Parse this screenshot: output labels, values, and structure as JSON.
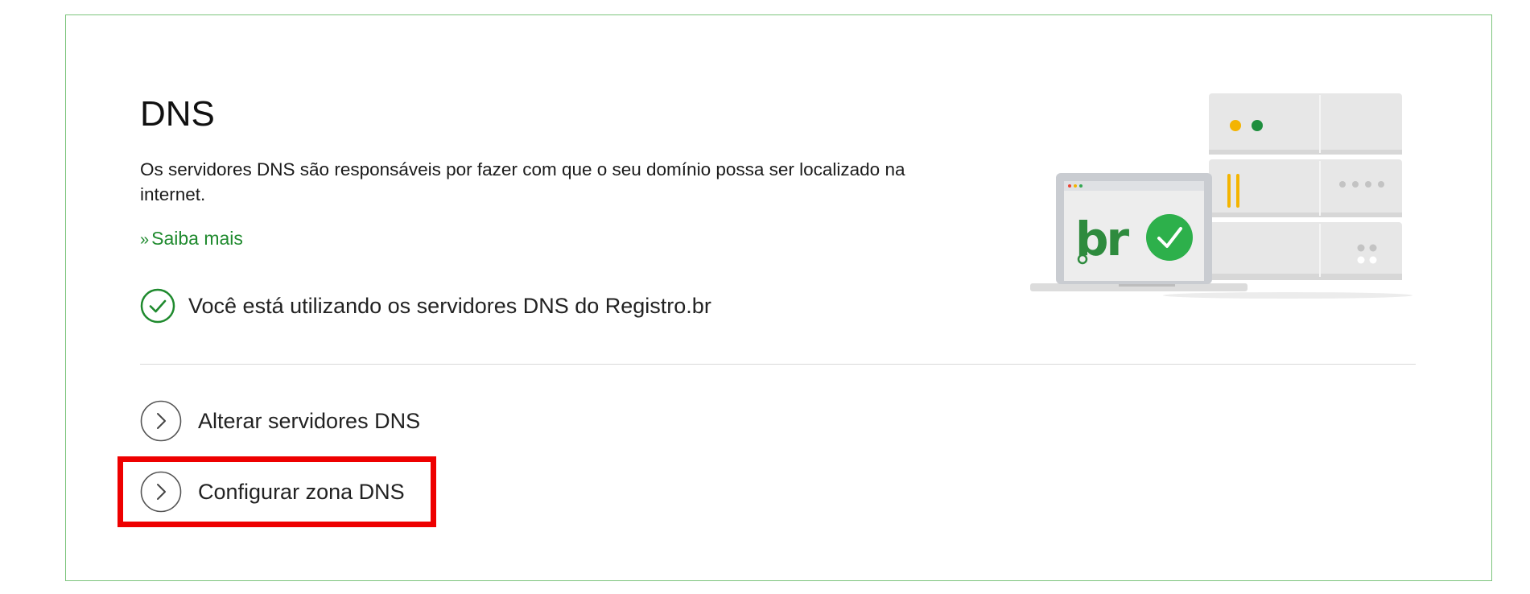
{
  "page": {
    "title": "DNS",
    "description": "Os servidores DNS são responsáveis por fazer com que o seu domínio possa ser localizado na internet.",
    "learn_more": {
      "prefix": "»",
      "label": "Saiba mais"
    },
    "status": {
      "icon": "check-circle-icon",
      "text": "Você está utilizando os servidores DNS do Registro.br"
    },
    "actions": [
      {
        "label": "Alterar servidores DNS",
        "icon": "chevron-right-icon"
      },
      {
        "label": "Configurar zona DNS",
        "icon": "chevron-right-icon",
        "highlighted": true
      }
    ],
    "illustration": {
      "logo_text": "br",
      "icon": "server-laptop-illustration"
    }
  },
  "colors": {
    "accent_green": "#1f8a2e",
    "card_border": "#7cc47c",
    "highlight_red": "#ee0000",
    "check_badge": "#2db04b",
    "led_yellow": "#f4b400",
    "led_green": "#1e8e3e"
  }
}
